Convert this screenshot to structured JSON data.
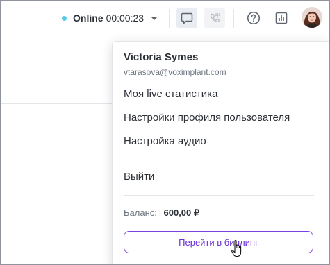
{
  "topbar": {
    "status": {
      "label": "Online",
      "timer": "00:00:23",
      "dot_color": "#55c9e6"
    },
    "icons": [
      "chat-icon",
      "phone-dialpad-icon",
      "help-icon",
      "statistics-icon"
    ]
  },
  "user_menu": {
    "name": "Victoria Symes",
    "email": "vtarasova@voximplant.com",
    "items": [
      "Моя live статистика",
      "Настройки профиля пользователя",
      "Настройка аудио"
    ],
    "logout": "Выйти",
    "balance_label": "Баланс:",
    "balance_value": "600,00 ₽",
    "billing_button": "Перейти в биллинг",
    "accent_color": "#7b3fe4"
  }
}
